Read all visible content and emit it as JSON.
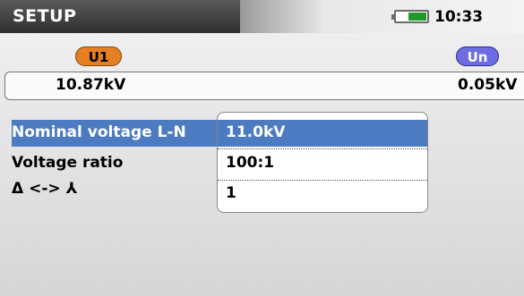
{
  "header": {
    "title": "SETUP",
    "time": "10:33",
    "battery_icon": "battery-icon"
  },
  "measurements": {
    "u1": {
      "label": "U1",
      "value": "10.87kV",
      "color": "#e67e22"
    },
    "un": {
      "label": "Un",
      "value": "0.05kV",
      "color": "#6d6ce2"
    }
  },
  "settings": {
    "selected_color": "#4d7bc2",
    "rows": [
      {
        "label": "Nominal voltage L-N",
        "value": "11.0kV",
        "selected": true
      },
      {
        "label": "Voltage ratio",
        "value": "100:1",
        "selected": false
      },
      {
        "label": "Δ <-> ⅄",
        "value": "1",
        "selected": false
      }
    ]
  }
}
